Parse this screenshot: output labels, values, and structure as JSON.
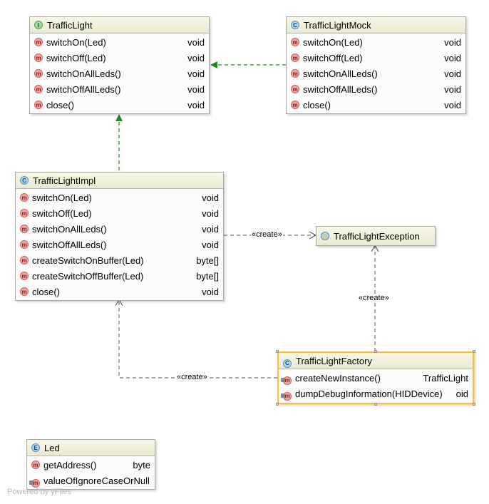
{
  "nodes": {
    "traffic_light": {
      "badge": "I",
      "title": "TrafficLight",
      "members": [
        {
          "badge": "m",
          "name": "switchOn(Led)",
          "type": "void"
        },
        {
          "badge": "m",
          "name": "switchOff(Led)",
          "type": "void"
        },
        {
          "badge": "m",
          "name": "switchOnAllLeds()",
          "type": "void"
        },
        {
          "badge": "m",
          "name": "switchOffAllLeds()",
          "type": "void"
        },
        {
          "badge": "m",
          "name": "close()",
          "type": "void"
        }
      ]
    },
    "traffic_light_mock": {
      "badge": "C",
      "title": "TrafficLightMock",
      "members": [
        {
          "badge": "m",
          "name": "switchOn(Led)",
          "type": "void"
        },
        {
          "badge": "m",
          "name": "switchOff(Led)",
          "type": "void"
        },
        {
          "badge": "m",
          "name": "switchOnAllLeds()",
          "type": "void"
        },
        {
          "badge": "m",
          "name": "switchOffAllLeds()",
          "type": "void"
        },
        {
          "badge": "m",
          "name": "close()",
          "type": "void"
        }
      ]
    },
    "traffic_light_impl": {
      "badge": "C",
      "title": "TrafficLightImpl",
      "members": [
        {
          "badge": "m",
          "name": "switchOn(Led)",
          "type": "void"
        },
        {
          "badge": "m",
          "name": "switchOff(Led)",
          "type": "void"
        },
        {
          "badge": "m",
          "name": "switchOnAllLeds()",
          "type": "void"
        },
        {
          "badge": "m",
          "name": "switchOffAllLeds()",
          "type": "void"
        },
        {
          "badge": "m",
          "name": "createSwitchOnBuffer(Led)",
          "type": "byte[]"
        },
        {
          "badge": "m",
          "name": "createSwitchOffBuffer(Led)",
          "type": "byte[]"
        },
        {
          "badge": "m",
          "name": "close()",
          "type": "void"
        }
      ]
    },
    "traffic_light_exception": {
      "badge": "⚡",
      "title": "TrafficLightException",
      "members": []
    },
    "traffic_light_factory": {
      "badge": "C",
      "title": "TrafficLightFactory",
      "members": [
        {
          "badge": "m",
          "name": "createNewInstance()",
          "type": "TrafficLight"
        },
        {
          "badge": "m",
          "name": "dumpDebugInformation(HIDDevice)",
          "type": "oid"
        }
      ]
    },
    "led": {
      "badge": "E",
      "title": "Led",
      "members": [
        {
          "badge": "m",
          "name": "getAddress()",
          "type": "byte"
        },
        {
          "badge": "m",
          "name": "valueOfIgnoreCaseOrNull",
          "type": ""
        }
      ]
    }
  },
  "edges": {
    "create_exception": "«create»",
    "factory_create_exception": "«create»",
    "factory_create_impl": "«create»"
  },
  "colors": {
    "realization": "#1f8a1f",
    "dependency": "#555555",
    "selection": "#f2c230"
  },
  "watermark": "Powered by yFiles"
}
